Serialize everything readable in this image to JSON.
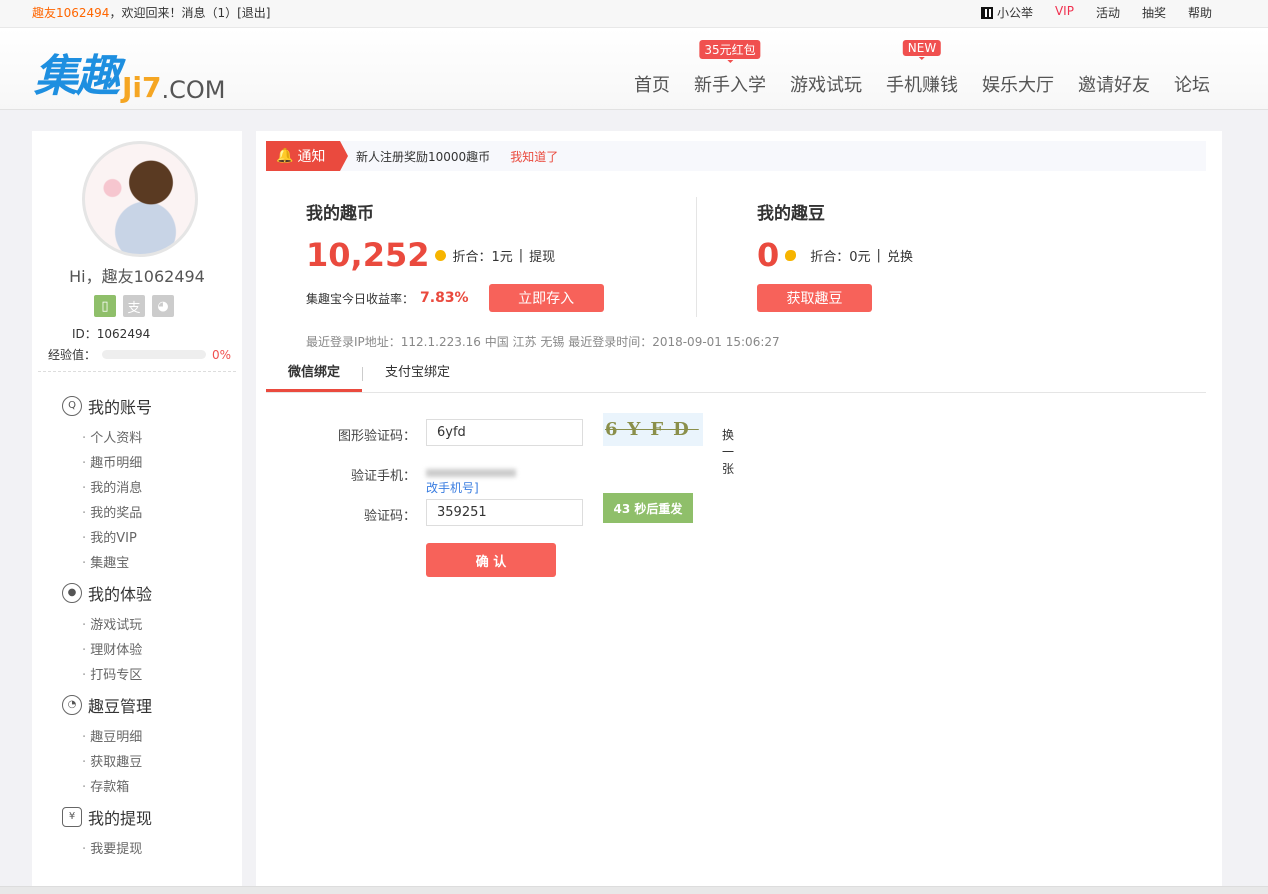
{
  "topbar": {
    "username": "趣友1062494",
    "welcome": "，欢迎回来！消息（1）",
    "logout": "[退出]",
    "links": [
      "小公举",
      "VIP",
      "活动",
      "抽奖",
      "帮助"
    ]
  },
  "logo": {
    "cn": "集趣",
    "en": "Ji7",
    "com": ".COM"
  },
  "nav": [
    {
      "label": "首页"
    },
    {
      "label": "新手入学",
      "badge": "35元红包"
    },
    {
      "label": "游戏试玩"
    },
    {
      "label": "手机赚钱",
      "badge": "NEW"
    },
    {
      "label": "娱乐大厅"
    },
    {
      "label": "邀请好友"
    },
    {
      "label": "论坛"
    }
  ],
  "sidebar": {
    "greeting": "Hi，趣友1062494",
    "id": "ID：1062494",
    "exp_label": "经验值：",
    "exp_pct": "0%",
    "exp_value": 0,
    "sections": [
      {
        "title": "我的账号",
        "items": [
          "个人资料",
          "趣币明细",
          "我的消息",
          "我的奖品",
          "我的VIP",
          "集趣宝"
        ]
      },
      {
        "title": "我的体验",
        "items": [
          "游戏试玩",
          "理财体验",
          "打码专区"
        ]
      },
      {
        "title": "趣豆管理",
        "items": [
          "趣豆明细",
          "获取趣豆",
          "存款箱"
        ]
      },
      {
        "title": "我的提现",
        "items": [
          "我要提现"
        ]
      }
    ]
  },
  "notice": {
    "tag": "通知",
    "text": "新人注册奖励10000趣币",
    "link": "我知道了"
  },
  "coins": {
    "title": "我的趣币",
    "value": "10,252",
    "equiv": "折合：1元",
    "action": "提现",
    "rate_label": "集趣宝今日收益率：",
    "rate": "7.83%",
    "button": "立即存入"
  },
  "beans": {
    "title": "我的趣豆",
    "value": "0",
    "equiv": "折合：0元",
    "action": "兑换",
    "button": "获取趣豆"
  },
  "login_info": "最近登录IP地址：112.1.223.16 中国 江苏 无锡 最近登录时间：2018-09-01 15:06:27",
  "tabs": [
    "微信绑定",
    "支付宝绑定"
  ],
  "form": {
    "captcha_label": "图形验证码：",
    "captcha_value": "6yfd",
    "captcha_image": "6YFD",
    "refresh": "换一张",
    "phone_label": "验证手机：",
    "change_phone": "改手机号]",
    "code_label": "验证码：",
    "code_value": "359251",
    "resend": "43 秒后重发",
    "confirm": "确 认"
  }
}
